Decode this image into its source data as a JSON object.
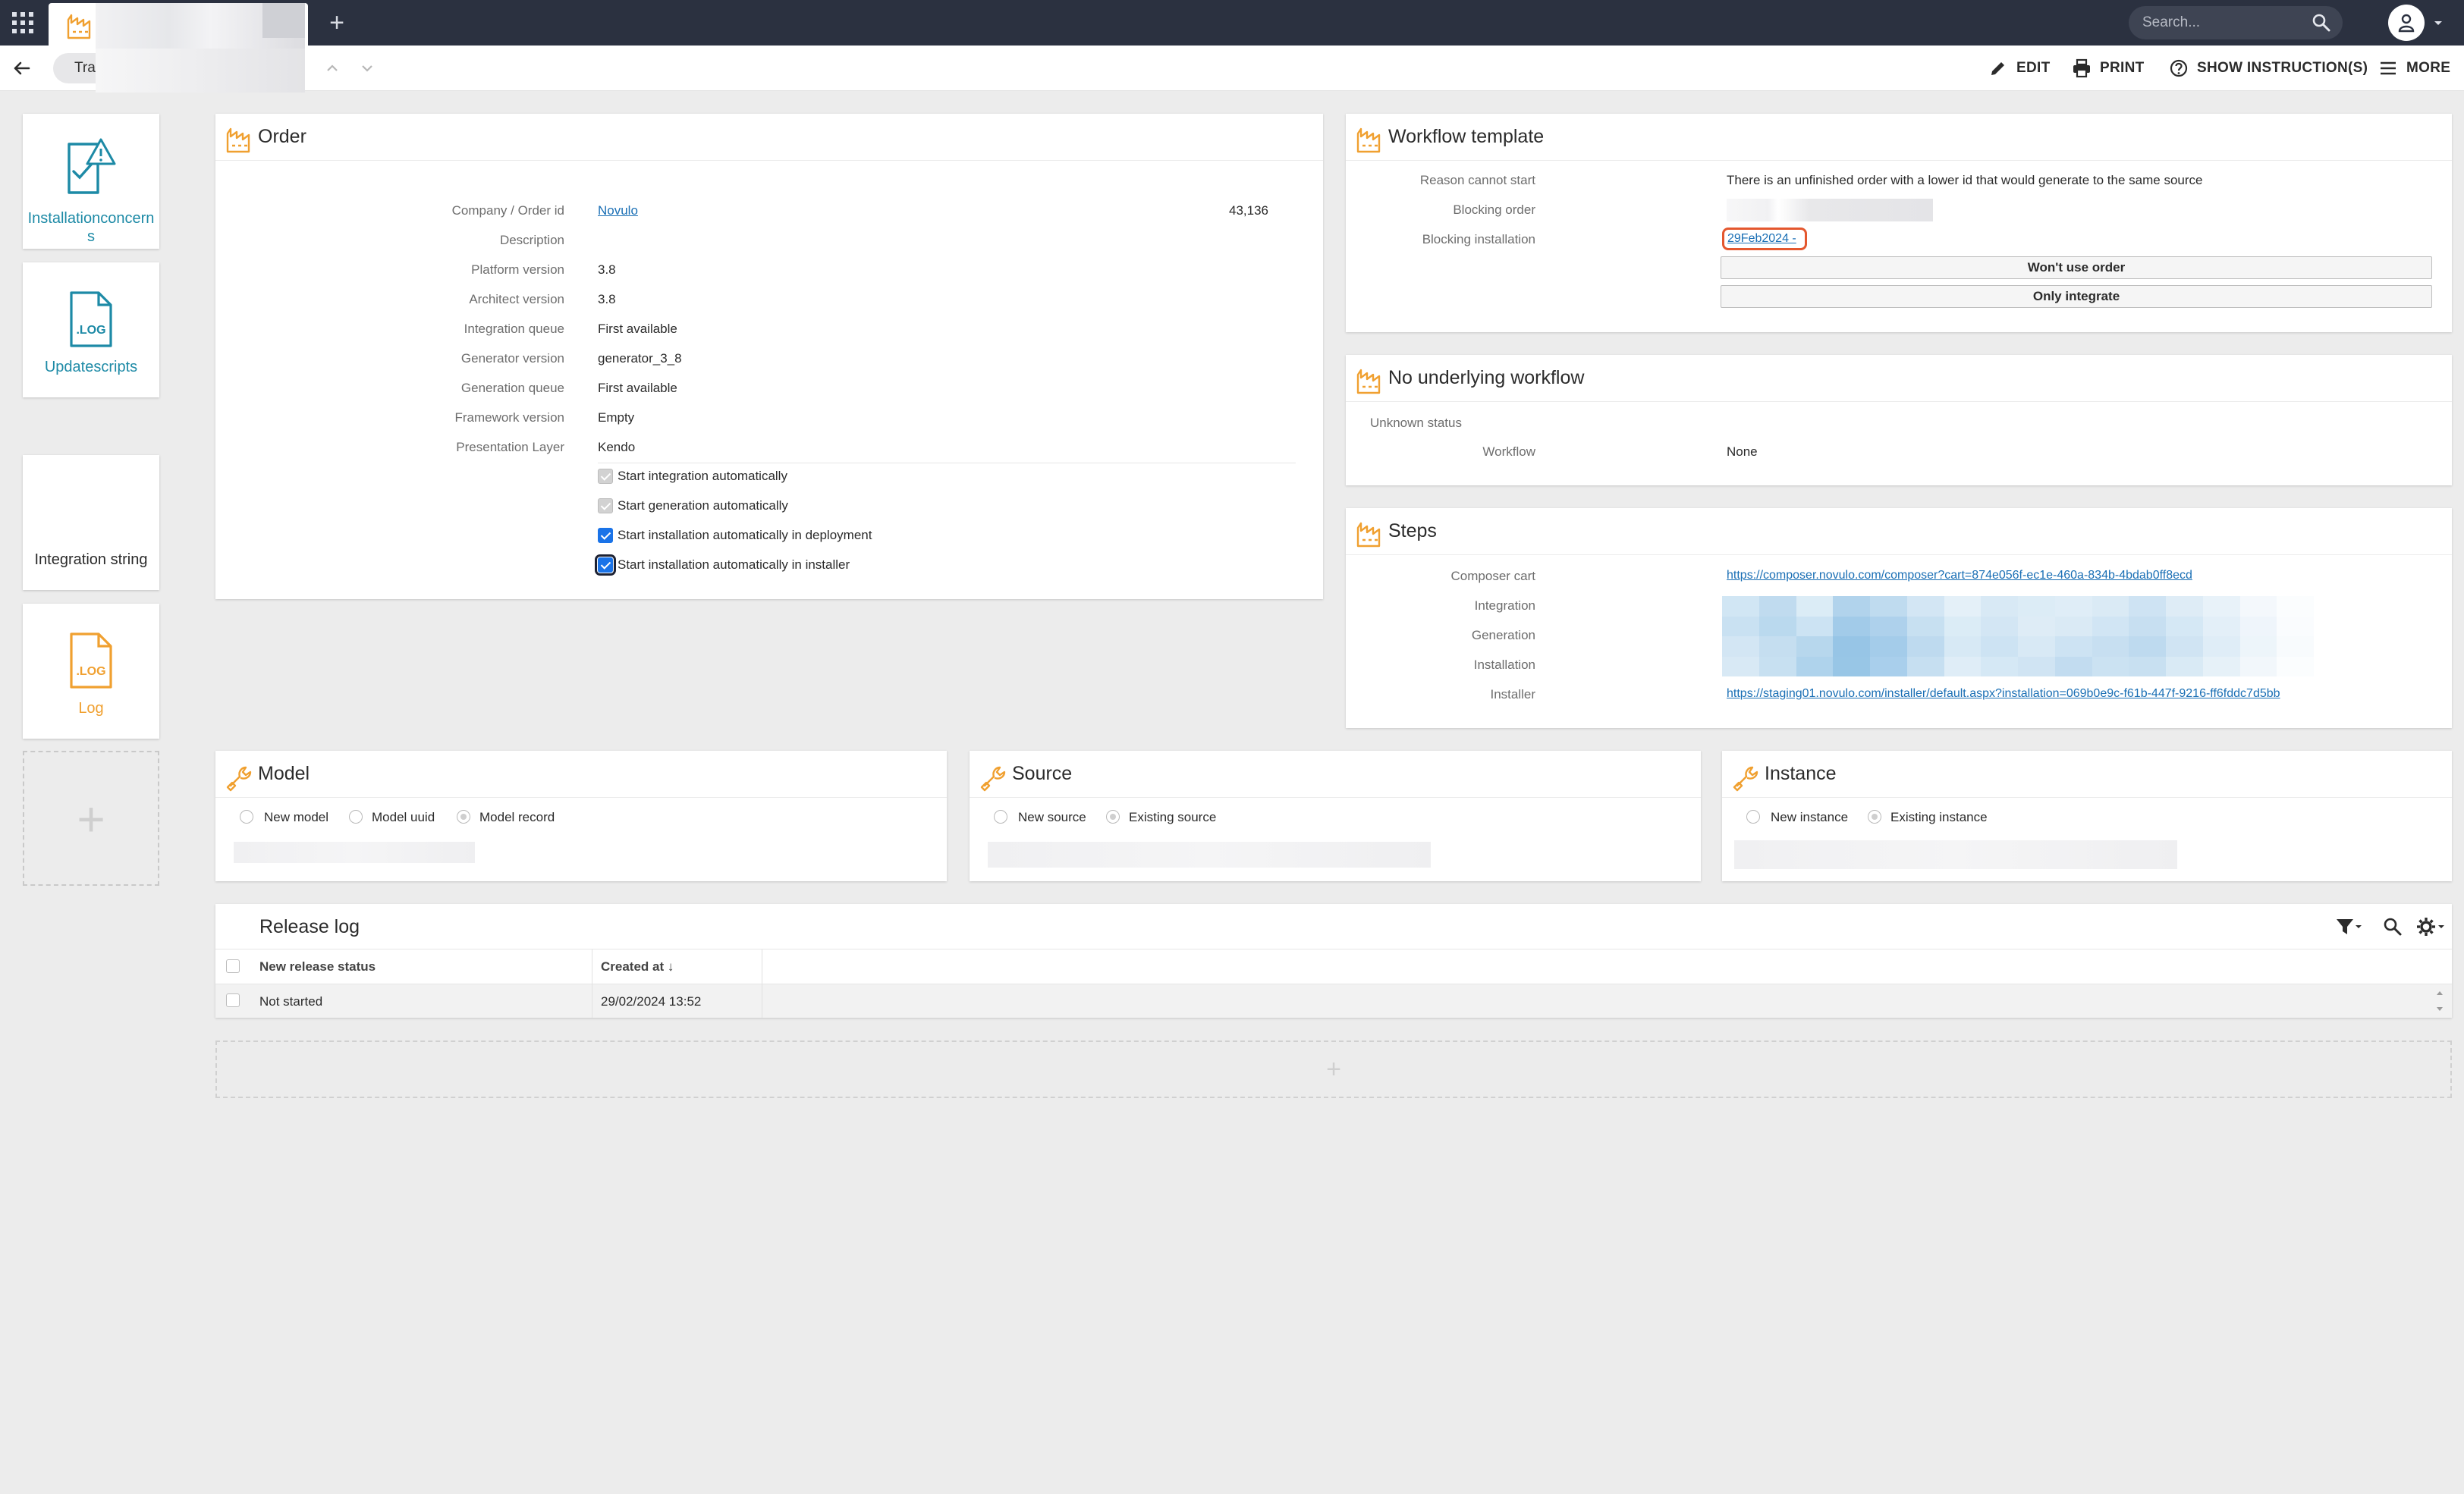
{
  "topbar": {
    "search_placeholder": "Search...",
    "add_tab_glyph": "+"
  },
  "toolbar": {
    "breadcrumb": "Trai",
    "edit_label": "EDIT",
    "print_label": "PRINT",
    "instructions_label": "SHOW INSTRUCTION(S)",
    "more_label": "MORE"
  },
  "sidebar": {
    "items": [
      {
        "label": "Installationconcerns",
        "icon": "document-warning-icon"
      },
      {
        "label": "Updatescripts",
        "icon": "log-file-icon"
      },
      {
        "label": "Integration string",
        "icon": ""
      },
      {
        "label": "Log",
        "icon": "log-file-icon"
      }
    ],
    "add_glyph": "+"
  },
  "order": {
    "title": "Order",
    "fields": {
      "company_label": "Company / Order id",
      "company_value": "Novulo",
      "order_id": "43,136",
      "description_label": "Description",
      "description_value": "",
      "platform_label": "Platform version",
      "platform_value": "3.8",
      "architect_label": "Architect version",
      "architect_value": "3.8",
      "integration_queue_label": "Integration queue",
      "integration_queue_value": "First available",
      "generator_label": "Generator version",
      "generator_value": "generator_3_8",
      "generation_queue_label": "Generation queue",
      "generation_queue_value": "First available",
      "framework_label": "Framework version",
      "framework_value": "Empty",
      "presentation_label": "Presentation Layer",
      "presentation_value": "Kendo"
    },
    "checkboxes": [
      {
        "label": "Start integration automatically",
        "checked": true,
        "enabled": false
      },
      {
        "label": "Start generation automatically",
        "checked": true,
        "enabled": false
      },
      {
        "label": "Start installation automatically in deployment",
        "checked": true,
        "enabled": true
      },
      {
        "label": "Start installation automatically in installer",
        "checked": true,
        "enabled": true
      }
    ]
  },
  "workflow_template": {
    "title": "Workflow template",
    "reason_label": "Reason cannot start",
    "reason_value": "There is an unfinished order with a lower id that would generate to the same source",
    "blocking_order_label": "Blocking order",
    "blocking_installation_label": "Blocking installation",
    "blocking_installation_value": "29Feb2024 -",
    "wont_use_button": "Won't use order",
    "only_integrate_button": "Only integrate"
  },
  "no_underlying_workflow": {
    "title": "No underlying workflow",
    "status": "Unknown status",
    "workflow_label": "Workflow",
    "workflow_value": "None"
  },
  "steps": {
    "title": "Steps",
    "composer_label": "Composer cart",
    "composer_url": "https://composer.novulo.com/composer?cart=874e056f-ec1e-460a-834b-4bdab0ff8ecd",
    "integration_label": "Integration",
    "generation_label": "Generation",
    "installation_label": "Installation",
    "installer_label": "Installer",
    "installer_url": "https://staging01.novulo.com/installer/default.aspx?installation=069b0e9c-f61b-447f-9216-ff6fddc7d5bb"
  },
  "model": {
    "title": "Model",
    "options": [
      "New model",
      "Model uuid",
      "Model record"
    ],
    "selected": "Model record"
  },
  "source": {
    "title": "Source",
    "options": [
      "New source",
      "Existing source"
    ],
    "selected": "Existing source"
  },
  "instance": {
    "title": "Instance",
    "options": [
      "New instance",
      "Existing instance"
    ],
    "selected": "Existing instance"
  },
  "release_log": {
    "title": "Release log",
    "columns": [
      "New release status",
      "Created at ↓"
    ],
    "rows": [
      {
        "status": "Not started",
        "created_at": "29/02/2024 13:52"
      }
    ],
    "add_glyph": "+"
  },
  "colors": {
    "topbar_bg": "#2b3140",
    "accent_orange": "#f0a030",
    "link_blue": "#1a6fb5",
    "teal_icon": "#1d8aa6",
    "checkbox_blue": "#1a73e8",
    "highlight_red": "#e4572e"
  }
}
